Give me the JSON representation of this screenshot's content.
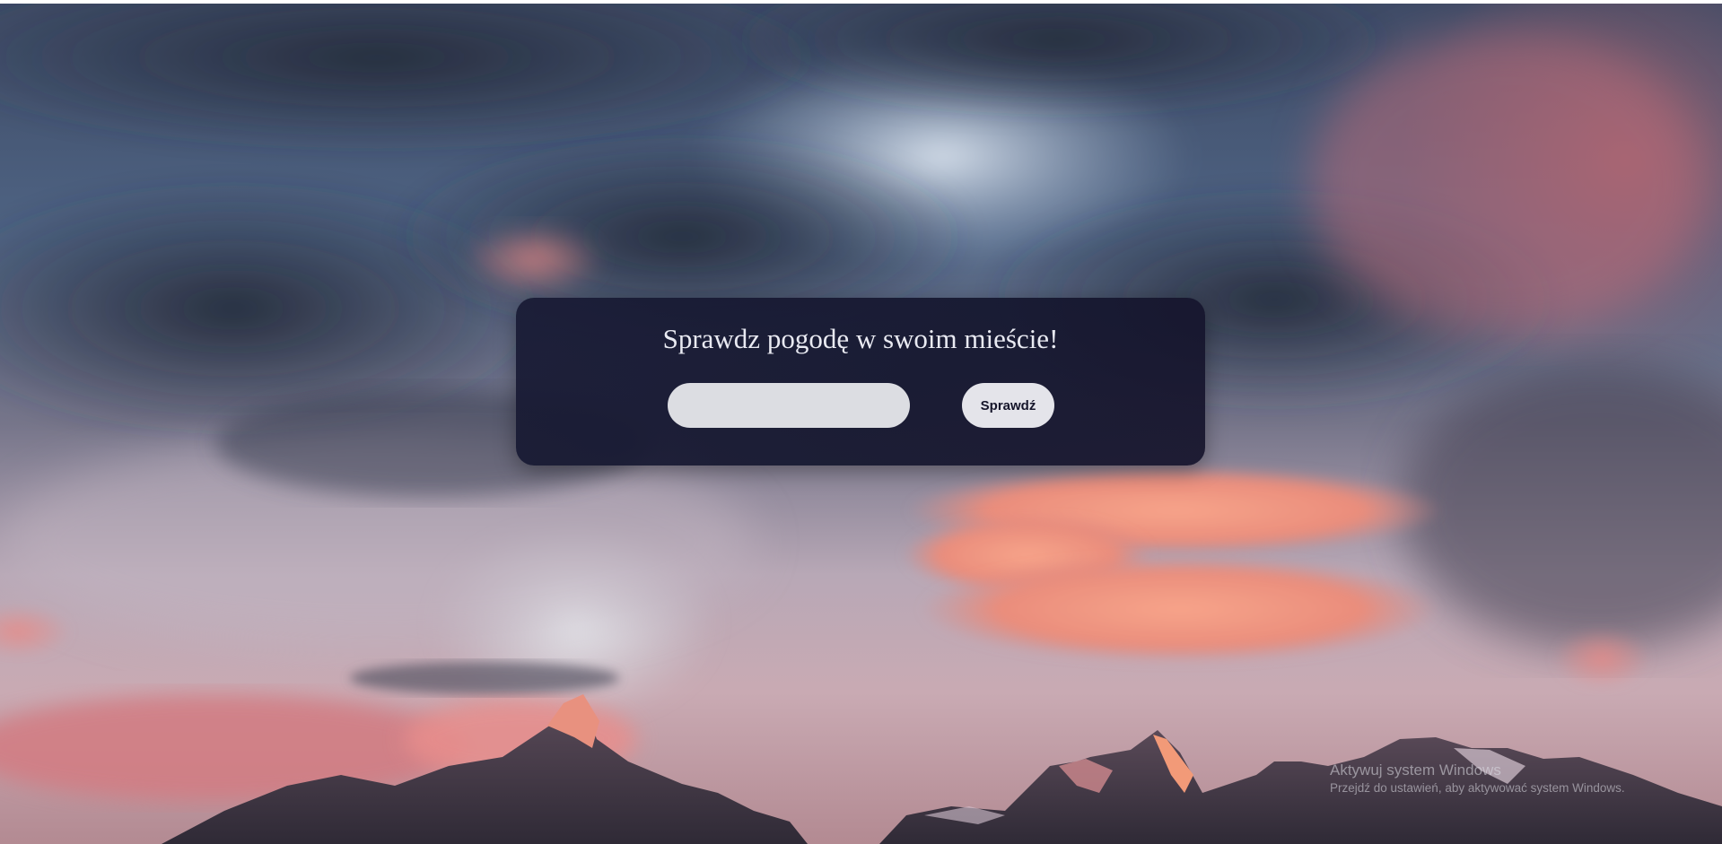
{
  "background": {
    "description_colors": {
      "sky_top": "#3d4a66",
      "storm_cloud": "#2b3448",
      "pink_glow": "#ef8c78",
      "haze": "#c7b2bc"
    }
  },
  "weather_form": {
    "title": "Sprawdz pogodę w swoim mieście!",
    "city_input_value": "",
    "city_input_placeholder": "",
    "submit_label": "Sprawdź"
  },
  "os_watermark": {
    "title": "Aktywuj system Windows",
    "subtitle": "Przejdź do ustawień, aby aktywować system Windows."
  }
}
